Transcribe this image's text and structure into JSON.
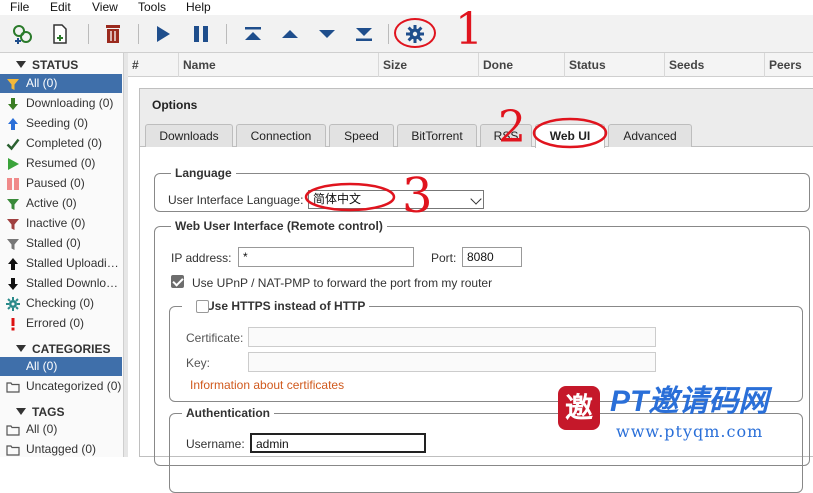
{
  "menu": {
    "file": "File",
    "edit": "Edit",
    "view": "View",
    "tools": "Tools",
    "help": "Help"
  },
  "toolbar": {
    "icons": [
      "add-torrent-link-icon",
      "add-torrent-file-icon",
      "delete-icon",
      "resume-icon",
      "pause-icon",
      "top-priority-icon",
      "increase-priority-icon",
      "decrease-priority-icon",
      "bottom-priority-icon",
      "options-gear-icon"
    ]
  },
  "sidebar": {
    "status_title": "STATUS",
    "status_items": [
      {
        "label": "All (0)",
        "icon": "filter-icon",
        "color": "#e0a030"
      },
      {
        "label": "Downloading (0)",
        "icon": "download-arrow-icon",
        "color": "#3a7d23"
      },
      {
        "label": "Seeding (0)",
        "icon": "upload-arrow-icon",
        "color": "#2b6fd8"
      },
      {
        "label": "Completed (0)",
        "icon": "checkmark-icon",
        "color": "#2a6030"
      },
      {
        "label": "Resumed (0)",
        "icon": "play-icon",
        "color": "#3aa33a"
      },
      {
        "label": "Paused (0)",
        "icon": "pause-icon",
        "color": "#f08a8a"
      },
      {
        "label": "Active (0)",
        "icon": "filter-icon",
        "color": "#3a8a3a"
      },
      {
        "label": "Inactive (0)",
        "icon": "filter-icon",
        "color": "#a04040"
      },
      {
        "label": "Stalled (0)",
        "icon": "filter-icon",
        "color": "#777777"
      },
      {
        "label": "Stalled Uploadi…",
        "icon": "up-arrow-icon",
        "color": "#111111"
      },
      {
        "label": "Stalled Downlo…",
        "icon": "down-arrow-icon",
        "color": "#111111"
      },
      {
        "label": "Checking (0)",
        "icon": "gear-icon",
        "color": "#2a8a8a"
      },
      {
        "label": "Errored (0)",
        "icon": "exclamation-icon",
        "color": "#dd1111"
      }
    ],
    "categories_title": "CATEGORIES",
    "categories_items": [
      "All (0)",
      "Uncategorized (0)"
    ],
    "tags_title": "TAGS",
    "tags_items": [
      "All (0)",
      "Untagged (0)"
    ]
  },
  "table": {
    "columns": [
      "#",
      "Name",
      "Size",
      "Done",
      "Status",
      "Seeds",
      "Peers"
    ]
  },
  "options": {
    "title": "Options",
    "tabs": [
      "Downloads",
      "Connection",
      "Speed",
      "BitTorrent",
      "RSS",
      "Web UI",
      "Advanced"
    ],
    "active_tab": "Web UI",
    "language": {
      "legend": "Language",
      "label": "User Interface Language:",
      "value": "简体中文"
    },
    "webui": {
      "legend": "Web User Interface (Remote control)",
      "ip_label": "IP address:",
      "ip_value": "*",
      "port_label": "Port:",
      "port_value": "8080",
      "upnp_label": "Use UPnP / NAT-PMP to forward the port from my router",
      "upnp_checked": true
    },
    "https": {
      "legend": "Use HTTPS instead of HTTP",
      "checked": false,
      "cert_label": "Certificate:",
      "key_label": "Key:",
      "info_link": "Information about certificates"
    },
    "auth": {
      "legend": "Authentication",
      "username_label": "Username:",
      "username_value": "admin"
    }
  },
  "annotations": {
    "one": "1",
    "two": "2",
    "three": "3"
  },
  "watermark": {
    "logo_char": "邀",
    "title": "PT邀请码网",
    "url": "www.ptyqm.com"
  },
  "colors": {
    "accent": "#3f6faa",
    "annotation_red": "#e0141e",
    "toolbar_blue": "#1f4e8c",
    "trash_red": "#9b2a1e"
  }
}
